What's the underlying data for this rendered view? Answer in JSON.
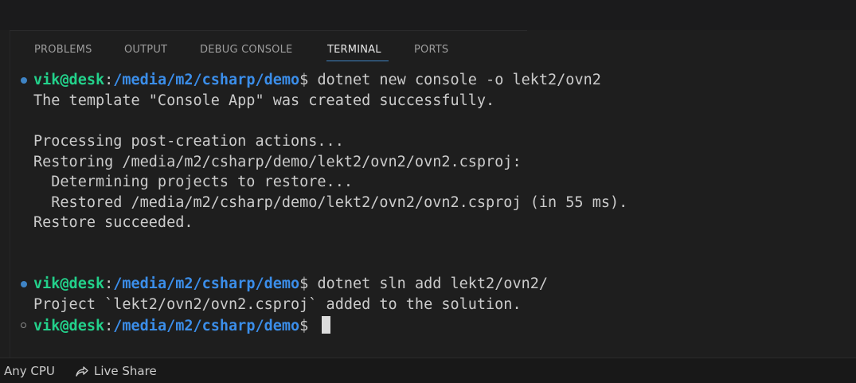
{
  "panel": {
    "tabs": [
      {
        "label": "PROBLEMS"
      },
      {
        "label": "OUTPUT"
      },
      {
        "label": "DEBUG CONSOLE"
      },
      {
        "label": "TERMINAL",
        "active": true
      },
      {
        "label": "PORTS"
      }
    ]
  },
  "terminal": {
    "prompt_user": "vik@desk",
    "prompt_sep": ":",
    "prompt_path": "/media/m2/csharp/demo",
    "prompt_symbol": "$ ",
    "cmd1": "dotnet new console -o lekt2/ovn2",
    "out1": "The template \"Console App\" was created successfully.",
    "out2": "Processing post-creation actions...",
    "out3": "Restoring /media/m2/csharp/demo/lekt2/ovn2/ovn2.csproj:",
    "out4": "  Determining projects to restore...",
    "out5": "  Restored /media/m2/csharp/demo/lekt2/ovn2/ovn2.csproj (in 55 ms).",
    "out6": "Restore succeeded.",
    "cmd2": "dotnet sln add lekt2/ovn2/",
    "out7": "Project `lekt2/ovn2/ovn2.csproj` added to the solution."
  },
  "statusbar": {
    "platform": "Any CPU",
    "live_share": "Live Share",
    "live_share_icon": "live-share-icon"
  },
  "colors": {
    "user": "#23d18b",
    "path": "#3b8eea",
    "accent": "#3f84c5"
  }
}
